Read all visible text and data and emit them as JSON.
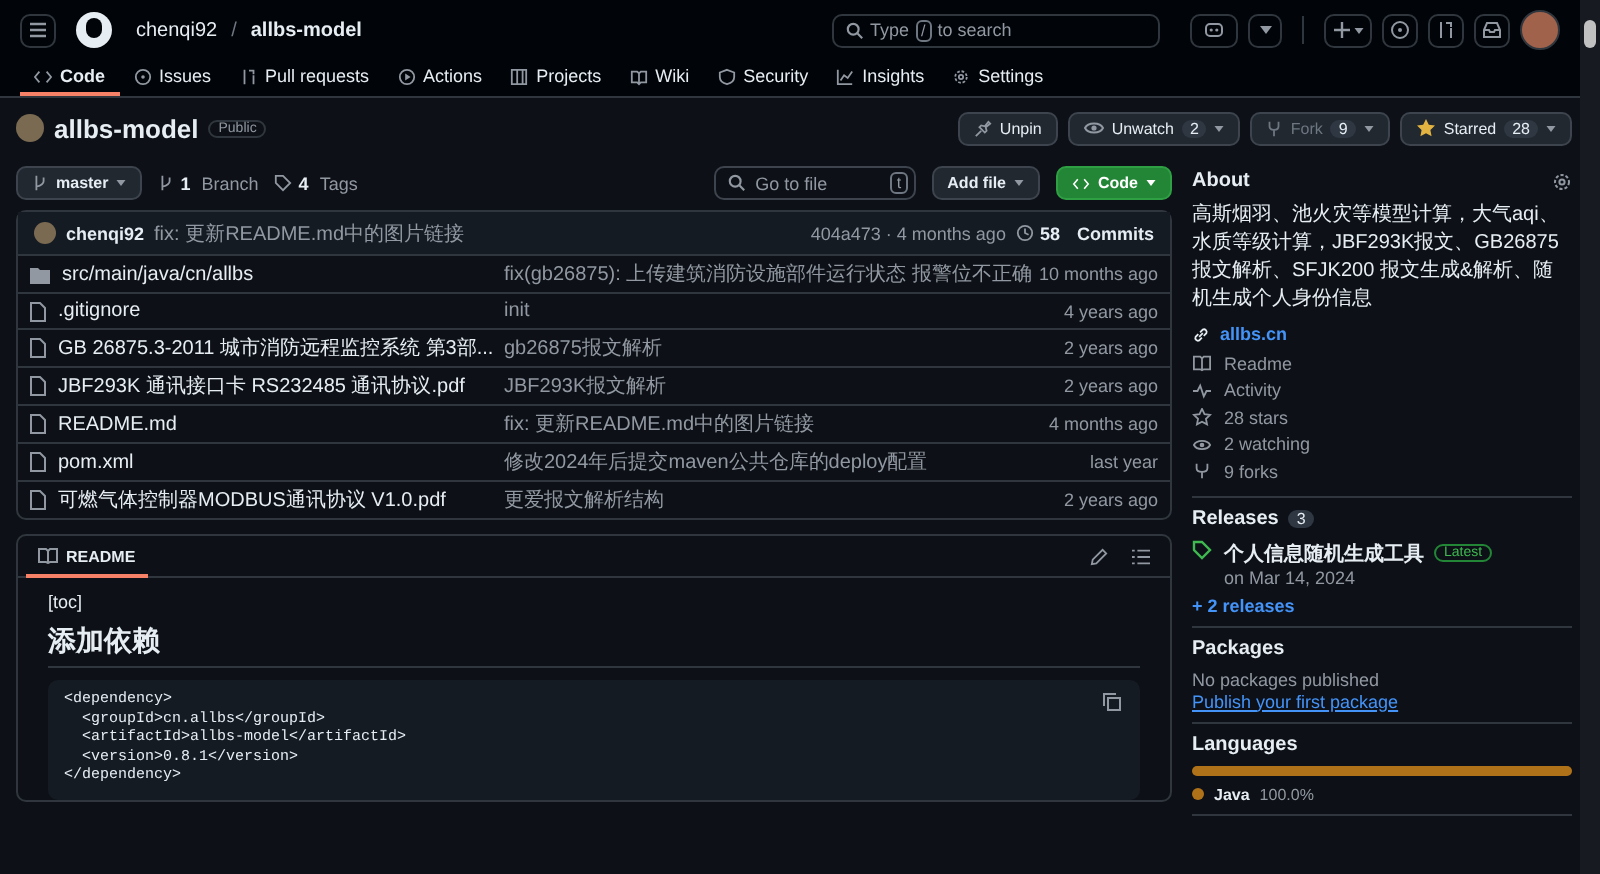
{
  "header": {
    "owner": "chenqi92",
    "separator": "/",
    "repo": "allbs-model",
    "search_before": "Type",
    "search_key": "/",
    "search_after": "to search"
  },
  "nav_tabs": [
    {
      "kind": "code",
      "label": "Code",
      "selected": true
    },
    {
      "kind": "issues",
      "label": "Issues",
      "selected": false
    },
    {
      "kind": "pulls",
      "label": "Pull requests",
      "selected": false
    },
    {
      "kind": "actions",
      "label": "Actions",
      "selected": false
    },
    {
      "kind": "projects",
      "label": "Projects",
      "selected": false
    },
    {
      "kind": "wiki",
      "label": "Wiki",
      "selected": false
    },
    {
      "kind": "security",
      "label": "Security",
      "selected": false
    },
    {
      "kind": "insights",
      "label": "Insights",
      "selected": false
    },
    {
      "kind": "settings",
      "label": "Settings",
      "selected": false
    }
  ],
  "repo": {
    "name": "allbs-model",
    "visibility": "Public",
    "pin": "Unpin",
    "watch": "Unwatch",
    "watch_count": "2",
    "fork": "Fork",
    "fork_count": "9",
    "star": "Starred",
    "star_count": "28"
  },
  "file_toolbar": {
    "branch": "master",
    "branch_count": "1",
    "branch_label": "Branch",
    "tag_count": "4",
    "tag_label": "Tags",
    "go_to_file": "Go to file",
    "shortcut": "t",
    "add_file": "Add file",
    "code": "Code"
  },
  "latest_commit": {
    "author": "chenqi92",
    "message": "fix: 更新README.md中的图片链接",
    "hash_time": "404a473 · 4 months ago",
    "commits_count": "58",
    "commits_label": "Commits"
  },
  "files": [
    {
      "kind": "folder",
      "name": "src/main/java/cn/allbs",
      "message": "fix(gb26875): 上传建筑消防设施部件运行状态 报警位不正确",
      "time": "10 months ago"
    },
    {
      "kind": "file",
      "name": ".gitignore",
      "message": "init",
      "time": "4 years ago"
    },
    {
      "kind": "file",
      "name": "GB 26875.3-2011 城市消防远程监控系统 第3部...",
      "message": "gb26875报文解析",
      "time": "2 years ago"
    },
    {
      "kind": "file",
      "name": "JBF293K 通讯接口卡 RS232485 通讯协议.pdf",
      "message": "JBF293K报文解析",
      "time": "2 years ago"
    },
    {
      "kind": "file",
      "name": "README.md",
      "message": "fix: 更新README.md中的图片链接",
      "time": "4 months ago"
    },
    {
      "kind": "file",
      "name": "pom.xml",
      "message": "修改2024年后提交maven公共仓库的deploy配置",
      "time": "last year"
    },
    {
      "kind": "file",
      "name": "可燃气体控制器MODBUS通讯协议 V1.0.pdf",
      "message": "更爱报文解析结构",
      "time": "2 years ago"
    }
  ],
  "readme": {
    "tab": "README",
    "toc": "[toc]",
    "heading": "添加依赖",
    "code_lines": [
      "<dependency>",
      "  <groupId>cn.allbs</groupId>",
      "  <artifactId>allbs-model</artifactId>",
      "  <version>0.8.1</version>",
      "</dependency>"
    ]
  },
  "about": {
    "title": "About",
    "description": "高斯烟羽、池火灾等模型计算，大气aqi、水质等级计算，JBF293K报文、GB26875报文解析、SFJK200 报文生成&解析、随机生成个人身份信息",
    "website": "allbs.cn",
    "stats": [
      {
        "kind": "readme",
        "label": "Readme"
      },
      {
        "kind": "activity",
        "label": "Activity"
      },
      {
        "kind": "star",
        "label": "28 stars"
      },
      {
        "kind": "eye",
        "label": "2 watching"
      },
      {
        "kind": "fork",
        "label": "9 forks"
      }
    ]
  },
  "releases": {
    "title": "Releases",
    "count": "3",
    "latest_name": "个人信息随机生成工具",
    "latest_badge": "Latest",
    "latest_date": "on Mar 14, 2024",
    "more": "+ 2 releases"
  },
  "packages": {
    "title": "Packages",
    "empty": "No packages published",
    "link": "Publish your first package"
  },
  "languages": {
    "title": "Languages",
    "items": [
      {
        "name": "Java",
        "percent": "100.0%",
        "color": "#b07219",
        "level": 1
      }
    ]
  }
}
